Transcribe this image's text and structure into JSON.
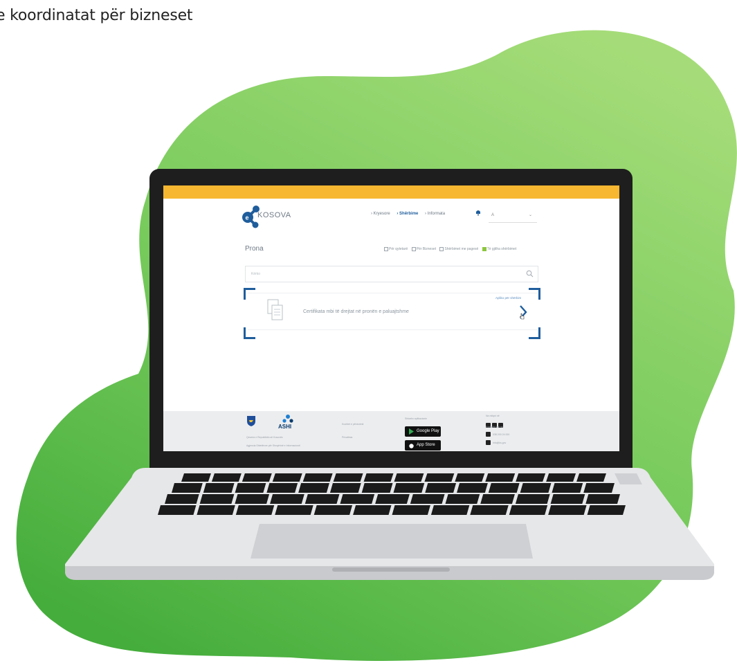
{
  "caption": "e koordinatat për bizneset",
  "colors": {
    "blob_light": "#a5dc79",
    "blob_dark": "#4bb240",
    "topbar": "#f7b731",
    "accent_blue": "#1f5d9c",
    "footer_bg": "#ecedef"
  },
  "site": {
    "topbar_left": [
      "",
      "",
      "",
      ""
    ],
    "topbar_right": [
      "",
      "",
      ""
    ],
    "logo_text": "KOSOVA",
    "nav": {
      "items": [
        "› Kryesore",
        "› Shërbime",
        "› Informata"
      ],
      "active_index": 1
    },
    "page_title": "Prona",
    "filters": [
      {
        "label": "Për qytetarë",
        "checked": false
      },
      {
        "label": "Për Bizneset",
        "checked": false
      },
      {
        "label": "Shërbimet me pagesë",
        "checked": false
      },
      {
        "label": "Të gjitha shërbimet",
        "checked": true
      }
    ],
    "search": {
      "placeholder": "Kërko"
    },
    "result": {
      "label": "Certifikata mbi të drejtat në pronën e paluajtshme",
      "link": "Apliko për shërbim"
    },
    "footer": {
      "org_line1": "Qeveria e Republikës së Kosovës",
      "org_line2": "Agjencia Shtetërore për Shoqërinë e Informacionit",
      "col_links": [
        "Kushtet e përdorimit",
        "Privatësia"
      ],
      "download_label": "Shkarko aplikacionin",
      "google_play": "Google Play",
      "app_store": "App Store",
      "follow_label": "Na ndiqni në",
      "contact_label": "Kontakto me ne",
      "phone": "038 200 24 000",
      "email": "info@ks.gov"
    },
    "brand_ashi": "ASHI"
  }
}
